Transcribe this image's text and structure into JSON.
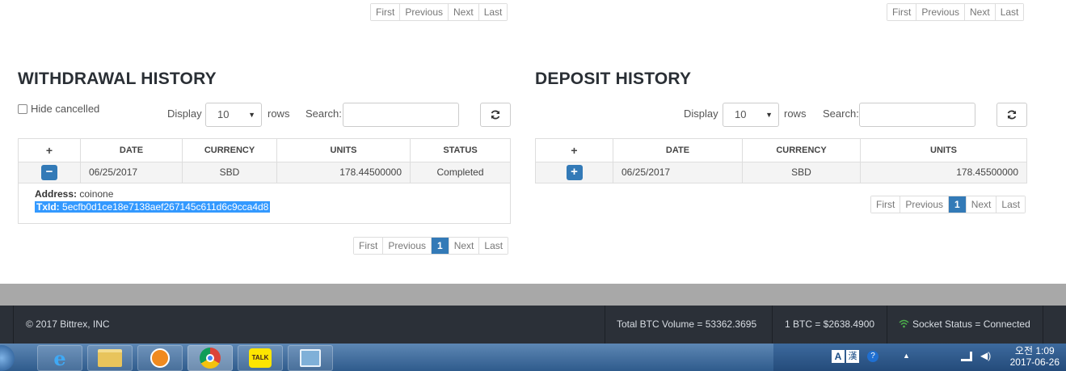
{
  "pagination_top": {
    "first": "First",
    "previous": "Previous",
    "next": "Next",
    "last": "Last"
  },
  "withdrawal": {
    "title": "WITHDRAWAL HISTORY",
    "hide_cancelled_label": "Hide cancelled",
    "display_label": "Display",
    "rows_value": "10",
    "rows_label": "rows",
    "search_label": "Search:",
    "columns": {
      "toggle": "+",
      "date": "DATE",
      "currency": "CURRENCY",
      "units": "UNITS",
      "status": "STATUS"
    },
    "row": {
      "toggle": "−",
      "date": "06/25/2017",
      "currency": "SBD",
      "units": "178.44500000",
      "status": "Completed"
    },
    "detail": {
      "address_label": "Address:",
      "address": "coinone",
      "txid_label": "TxId:",
      "txid": "5ecfb0d1ce18e7138aef267145c611d6c9cca4d8"
    },
    "pagination": {
      "first": "First",
      "previous": "Previous",
      "page": "1",
      "next": "Next",
      "last": "Last"
    }
  },
  "deposit": {
    "title": "DEPOSIT HISTORY",
    "display_label": "Display",
    "rows_value": "10",
    "rows_label": "rows",
    "search_label": "Search:",
    "columns": {
      "toggle": "+",
      "date": "DATE",
      "currency": "CURRENCY",
      "units": "UNITS"
    },
    "row": {
      "toggle": "+",
      "date": "06/25/2017",
      "currency": "SBD",
      "units": "178.45500000"
    },
    "pagination": {
      "first": "First",
      "previous": "Previous",
      "page": "1",
      "next": "Next",
      "last": "Last"
    }
  },
  "footer": {
    "copyright": "© 2017 Bittrex, INC",
    "total_volume": "Total BTC Volume = 53362.3695",
    "btc_price": "1 BTC = $2638.4900",
    "socket_status": "Socket Status = Connected"
  },
  "taskbar": {
    "clock_time": "오전 1:09",
    "clock_date": "2017-06-26",
    "kakao_label": "TALK",
    "ime_a": "A",
    "ime_han": "漢"
  },
  "colors": {
    "accent": "#337ab7",
    "footer_bg": "#2b3038",
    "selection": "#3399ff"
  }
}
